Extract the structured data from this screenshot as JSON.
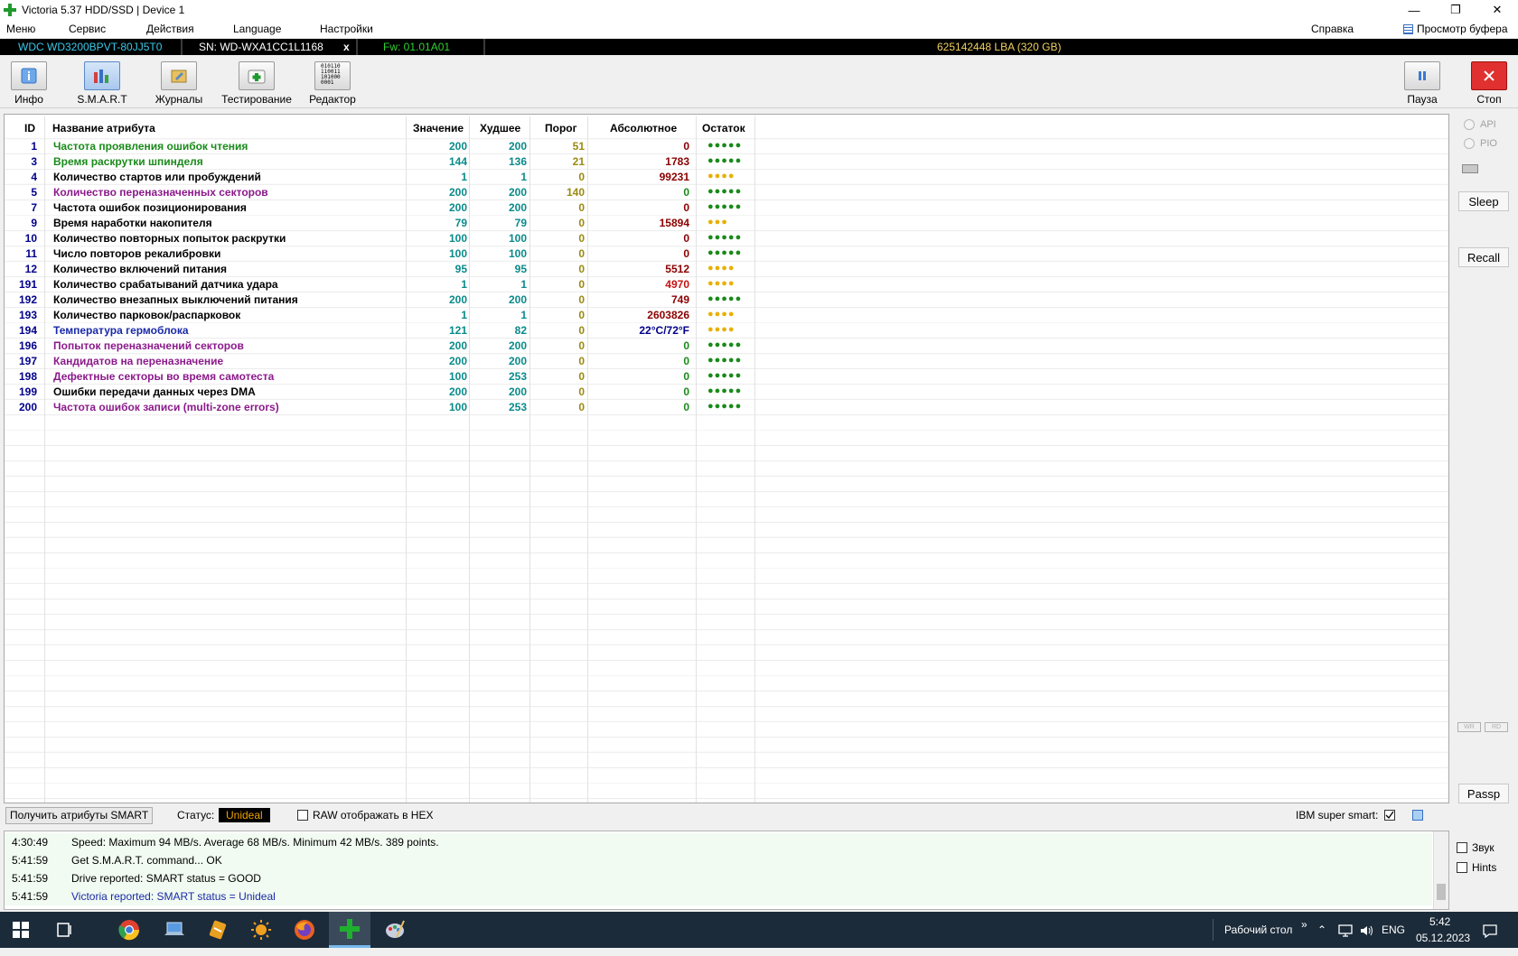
{
  "window": {
    "title": "Victoria 5.37 HDD/SSD | Device 1",
    "minimize": "—",
    "maximize": "❐",
    "close": "✕"
  },
  "menu": {
    "items": [
      "Меню",
      "Сервис",
      "Действия",
      "Language",
      "Настройки"
    ],
    "help": "Справка",
    "buffer_view": "Просмотр буфера"
  },
  "drive": {
    "model": "WDC WD3200BPVT-80JJ5T0",
    "serial": "SN: WD-WXA1CC1L1168",
    "close_x": "x",
    "firmware": "Fw: 01.01A01",
    "lba": "625142448 LBA (320 GB)"
  },
  "toolbar": {
    "info": "Инфо",
    "smart": "S.M.A.R.T",
    "journals": "Журналы",
    "testing": "Тестирование",
    "editor": "Редактор",
    "pause": "Пауза",
    "stop": "Стоп",
    "editor_icon_text": [
      "010110",
      "110011",
      "101000",
      "0001"
    ]
  },
  "table": {
    "headers": {
      "id": "ID",
      "name": "Название атрибута",
      "value": "Значение",
      "worst": "Худшее",
      "threshold": "Порог",
      "absolute": "Абсолютное",
      "remaining": "Остаток"
    },
    "rows": [
      {
        "id": "1",
        "name": "Частота проявления ошибок чтения",
        "value": "200",
        "worst": "200",
        "threshold": "51",
        "absolute": "0",
        "remaining": "●●●●●",
        "name_color": "#1a8a1a",
        "abs_color": "#8b0000",
        "rem_color": "#1a8a1a"
      },
      {
        "id": "3",
        "name": "Время раскрутки шпинделя",
        "value": "144",
        "worst": "136",
        "threshold": "21",
        "absolute": "1783",
        "remaining": "●●●●●",
        "name_color": "#1a8a1a",
        "abs_color": "#8b0000",
        "rem_color": "#1a8a1a"
      },
      {
        "id": "4",
        "name": "Количество стартов или пробуждений",
        "value": "1",
        "worst": "1",
        "threshold": "0",
        "absolute": "99231",
        "remaining": "●●●●",
        "name_color": "#000000",
        "abs_color": "#8b0000",
        "rem_color": "#e8b000"
      },
      {
        "id": "5",
        "name": "Количество переназначенных секторов",
        "value": "200",
        "worst": "200",
        "threshold": "140",
        "absolute": "0",
        "remaining": "●●●●●",
        "name_color": "#8b1a8b",
        "abs_color": "#1a8a1a",
        "rem_color": "#1a8a1a"
      },
      {
        "id": "7",
        "name": "Частота ошибок позиционирования",
        "value": "200",
        "worst": "200",
        "threshold": "0",
        "absolute": "0",
        "remaining": "●●●●●",
        "name_color": "#000000",
        "abs_color": "#8b0000",
        "rem_color": "#1a8a1a"
      },
      {
        "id": "9",
        "name": "Время наработки накопителя",
        "value": "79",
        "worst": "79",
        "threshold": "0",
        "absolute": "15894",
        "remaining": "●●●",
        "name_color": "#000000",
        "abs_color": "#8b0000",
        "rem_color": "#e8b000"
      },
      {
        "id": "10",
        "name": "Количество повторных попыток раскрутки",
        "value": "100",
        "worst": "100",
        "threshold": "0",
        "absolute": "0",
        "remaining": "●●●●●",
        "name_color": "#000000",
        "abs_color": "#8b0000",
        "rem_color": "#1a8a1a"
      },
      {
        "id": "11",
        "name": "Число повторов рекалибровки",
        "value": "100",
        "worst": "100",
        "threshold": "0",
        "absolute": "0",
        "remaining": "●●●●●",
        "name_color": "#000000",
        "abs_color": "#8b0000",
        "rem_color": "#1a8a1a"
      },
      {
        "id": "12",
        "name": "Количество включений питания",
        "value": "95",
        "worst": "95",
        "threshold": "0",
        "absolute": "5512",
        "remaining": "●●●●",
        "name_color": "#000000",
        "abs_color": "#8b0000",
        "rem_color": "#e8b000"
      },
      {
        "id": "191",
        "name": "Количество срабатываний датчика удара",
        "value": "1",
        "worst": "1",
        "threshold": "0",
        "absolute": "4970",
        "remaining": "●●●●",
        "name_color": "#000000",
        "abs_color": "#c81010",
        "rem_color": "#e8b000"
      },
      {
        "id": "192",
        "name": "Количество внезапных выключений питания",
        "value": "200",
        "worst": "200",
        "threshold": "0",
        "absolute": "749",
        "remaining": "●●●●●",
        "name_color": "#000000",
        "abs_color": "#8b0000",
        "rem_color": "#1a8a1a"
      },
      {
        "id": "193",
        "name": "Количество парковок/распарковок",
        "value": "1",
        "worst": "1",
        "threshold": "0",
        "absolute": "2603826",
        "remaining": "●●●●",
        "name_color": "#000000",
        "abs_color": "#8b0000",
        "rem_color": "#e8b000"
      },
      {
        "id": "194",
        "name": "Температура гермоблока",
        "value": "121",
        "worst": "82",
        "threshold": "0",
        "absolute": "22°C/72°F",
        "remaining": "●●●●",
        "name_color": "#1a2aa8",
        "abs_color": "#00008b",
        "rem_color": "#e8b000"
      },
      {
        "id": "196",
        "name": "Попыток переназначений секторов",
        "value": "200",
        "worst": "200",
        "threshold": "0",
        "absolute": "0",
        "remaining": "●●●●●",
        "name_color": "#8b1a8b",
        "abs_color": "#1a8a1a",
        "rem_color": "#1a8a1a"
      },
      {
        "id": "197",
        "name": "Кандидатов на переназначение",
        "value": "200",
        "worst": "200",
        "threshold": "0",
        "absolute": "0",
        "remaining": "●●●●●",
        "name_color": "#8b1a8b",
        "abs_color": "#1a8a1a",
        "rem_color": "#1a8a1a"
      },
      {
        "id": "198",
        "name": "Дефектные секторы во время самотеста",
        "value": "100",
        "worst": "253",
        "threshold": "0",
        "absolute": "0",
        "remaining": "●●●●●",
        "name_color": "#8b1a8b",
        "abs_color": "#1a8a1a",
        "rem_color": "#1a8a1a"
      },
      {
        "id": "199",
        "name": "Ошибки передачи данных через DMA",
        "value": "200",
        "worst": "200",
        "threshold": "0",
        "absolute": "0",
        "remaining": "●●●●●",
        "name_color": "#000000",
        "abs_color": "#1a8a1a",
        "rem_color": "#1a8a1a"
      },
      {
        "id": "200",
        "name": "Частота ошибок записи (multi-zone errors)",
        "value": "100",
        "worst": "253",
        "threshold": "0",
        "absolute": "0",
        "remaining": "●●●●●",
        "name_color": "#8b1a8b",
        "abs_color": "#1a8a1a",
        "rem_color": "#1a8a1a"
      }
    ]
  },
  "right_panel": {
    "api": "API",
    "pio": "PIO",
    "sleep": "Sleep",
    "recall": "Recall",
    "wr": "WR",
    "rd": "RD",
    "passp": "Passp"
  },
  "bottom": {
    "get_smart": "Получить атрибуты SMART",
    "status_label": "Статус:",
    "status_value": "Unideal",
    "raw_hex": "RAW отображать в HEX",
    "ibm_smart": "IBM super smart:"
  },
  "log": [
    {
      "time": "4:30:49",
      "msg": "Speed: Maximum 94 MB/s. Average 68 MB/s. Minimum 42 MB/s. 389 points.",
      "color": "#000000"
    },
    {
      "time": "5:41:59",
      "msg": "Get S.M.A.R.T. command... OK",
      "color": "#000000"
    },
    {
      "time": "5:41:59",
      "msg": "Drive reported: SMART status = GOOD",
      "color": "#000000"
    },
    {
      "time": "5:41:59",
      "msg": "Victoria reported: SMART status = Unideal",
      "color": "#1a2aa8"
    }
  ],
  "log_options": {
    "sound": "Звук",
    "hints": "Hints"
  },
  "taskbar": {
    "desktop": "Рабочий стол",
    "desktop_chevron": "»",
    "lang": "ENG",
    "time": "5:42",
    "date": "05.12.2023"
  }
}
